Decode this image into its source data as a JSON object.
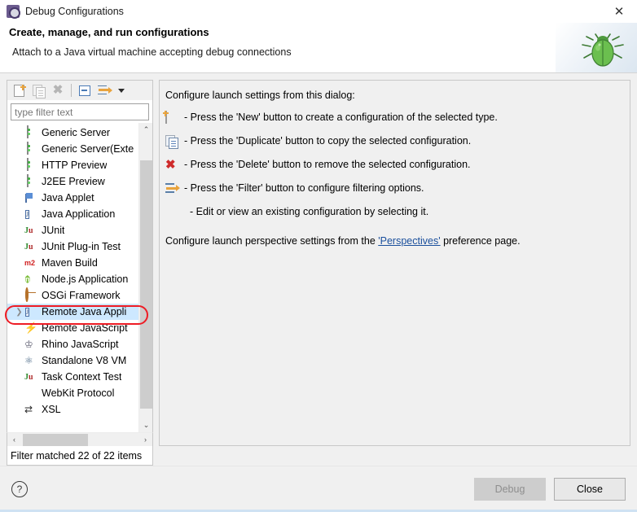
{
  "window": {
    "title": "Debug Configurations",
    "icon": "debug-configurations-icon",
    "close_label": "✕"
  },
  "header": {
    "title": "Create, manage, and run configurations",
    "subtitle": "Attach to a Java virtual machine accepting debug connections",
    "art_icon": "green-bug-icon"
  },
  "toolbar": {
    "items": [
      {
        "name": "new-configuration-button",
        "icon": "new-icon",
        "enabled": true
      },
      {
        "name": "duplicate-configuration-button",
        "icon": "duplicate-icon",
        "enabled": false
      },
      {
        "name": "delete-configuration-button",
        "icon": "delete-icon",
        "enabled": false
      },
      {
        "name": "collapse-all-button",
        "icon": "collapse-all-icon",
        "enabled": true
      },
      {
        "name": "filter-button",
        "icon": "filter-icon",
        "enabled": true
      },
      {
        "name": "view-menu-button",
        "icon": "chevron-down-icon",
        "enabled": true
      }
    ]
  },
  "filter": {
    "placeholder": "type filter text",
    "value": ""
  },
  "tree": {
    "selected": "Remote Java Appli",
    "items": [
      {
        "label": "Generic Server",
        "icon": "server-icon",
        "expandable": false,
        "selected": false
      },
      {
        "label": "Generic Server(Exte",
        "icon": "server-icon",
        "expandable": false,
        "selected": false
      },
      {
        "label": "HTTP Preview",
        "icon": "server-icon",
        "expandable": false,
        "selected": false
      },
      {
        "label": "J2EE Preview",
        "icon": "server-icon",
        "expandable": false,
        "selected": false
      },
      {
        "label": "Java Applet",
        "icon": "java-applet-icon",
        "expandable": false,
        "selected": false
      },
      {
        "label": "Java Application",
        "icon": "java-application-icon",
        "expandable": false,
        "selected": false
      },
      {
        "label": "JUnit",
        "icon": "junit-icon",
        "expandable": false,
        "selected": false
      },
      {
        "label": "JUnit Plug-in Test",
        "icon": "junit-plugin-icon",
        "expandable": false,
        "selected": false
      },
      {
        "label": "Maven Build",
        "icon": "maven-icon",
        "expandable": false,
        "selected": false
      },
      {
        "label": "Node.js Application",
        "icon": "nodejs-icon",
        "expandable": false,
        "selected": false
      },
      {
        "label": "OSGi Framework",
        "icon": "osgi-icon",
        "expandable": false,
        "selected": false
      },
      {
        "label": "Remote Java Appli",
        "icon": "remote-java-application-icon",
        "expandable": true,
        "selected": true
      },
      {
        "label": "Remote JavaScript",
        "icon": "remote-javascript-icon",
        "expandable": false,
        "selected": false
      },
      {
        "label": "Rhino JavaScript",
        "icon": "rhino-icon",
        "expandable": false,
        "selected": false
      },
      {
        "label": "Standalone V8 VM",
        "icon": "v8-icon",
        "expandable": false,
        "selected": false
      },
      {
        "label": "Task Context Test",
        "icon": "junit-icon",
        "expandable": false,
        "selected": false
      },
      {
        "label": "WebKit Protocol",
        "icon": "webkit-icon",
        "expandable": false,
        "selected": false
      },
      {
        "label": "XSL",
        "icon": "xsl-icon",
        "expandable": false,
        "selected": false
      }
    ],
    "status": "Filter matched 22 of 22 items",
    "scroll_up": "⌃",
    "scroll_down": "⌄",
    "scroll_left": "‹",
    "scroll_right": "›"
  },
  "details": {
    "intro": "Configure launch settings from this dialog:",
    "rows": [
      {
        "icon": "new-icon",
        "text": "- Press the 'New' button to create a configuration of the selected type."
      },
      {
        "icon": "duplicate-icon",
        "text": "- Press the 'Duplicate' button to copy the selected configuration."
      },
      {
        "icon": "delete-icon",
        "text": "- Press the 'Delete' button to remove the selected configuration."
      },
      {
        "icon": "filter-icon",
        "text": "- Press the 'Filter' button to configure filtering options."
      },
      {
        "icon": "none",
        "text": "- Edit or view an existing configuration by selecting it."
      }
    ],
    "footer_prefix": "Configure launch perspective settings from the ",
    "footer_link": "'Perspectives'",
    "footer_suffix": " preference page."
  },
  "footer": {
    "help_label": "?",
    "debug_label": "Debug",
    "debug_enabled": false,
    "close_label": "Close",
    "close_enabled": true
  },
  "annotation": {
    "shape": "red-rounded-rectangle",
    "target": "Remote Java Appli",
    "color": "#ee1c25"
  }
}
